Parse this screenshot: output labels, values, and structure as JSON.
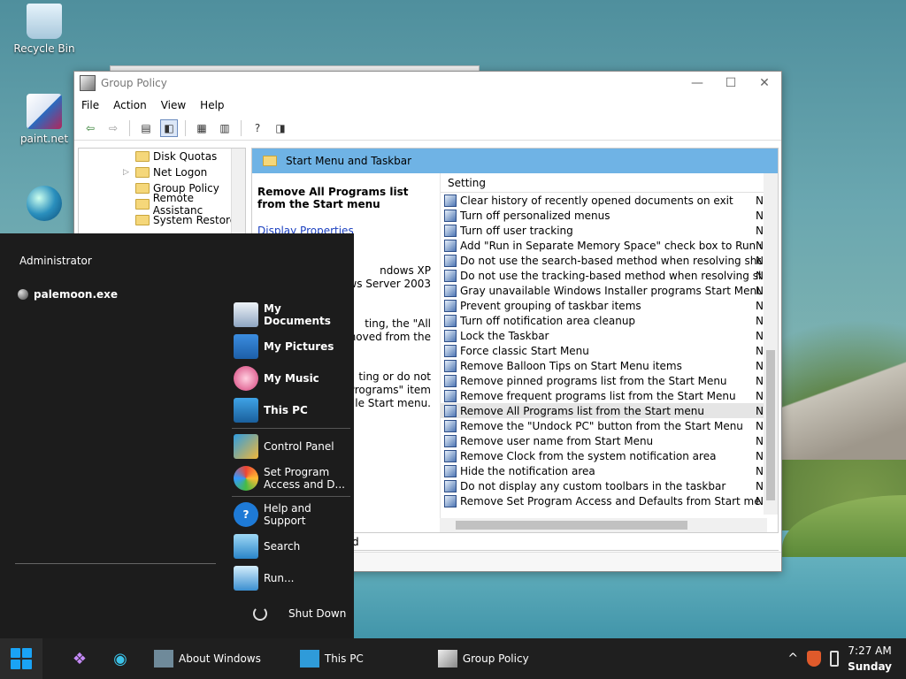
{
  "desktop": {
    "icons": [
      {
        "label": "Recycle Bin"
      },
      {
        "label": "paint.net"
      }
    ]
  },
  "group_policy": {
    "title": "Group Policy",
    "menu": [
      "File",
      "Action",
      "View",
      "Help"
    ],
    "tree_items": [
      "Disk Quotas",
      "Net Logon",
      "Group Policy",
      "Remote Assistanc",
      "System Restore"
    ],
    "header_title": "Start Menu and Taskbar",
    "description_title": "Remove All Programs list from the Start menu",
    "description_lines": [
      "Display Properties",
      "ndows XP",
      "ows Server 2003",
      "ting, the \"All",
      "moved from the",
      "ting or do not",
      "Programs\" item",
      "le Start menu."
    ],
    "column_header": "Setting",
    "settings": [
      "Clear history of recently opened documents on exit",
      "Turn off personalized menus",
      "Turn off user tracking",
      "Add \"Run in Separate Memory Space\" check box to Run dial...",
      "Do not use the search-based method when resolving shell s...",
      "Do not use the tracking-based method when resolving shell ...",
      "Gray unavailable Windows Installer programs Start Menu sh...",
      "Prevent grouping of taskbar items",
      "Turn off notification area cleanup",
      "Lock the Taskbar",
      "Force classic Start Menu",
      "Remove Balloon Tips on Start Menu items",
      "Remove pinned programs list from the Start Menu",
      "Remove frequent programs list from the Start Menu",
      "Remove All Programs list from the Start menu",
      "Remove the \"Undock PC\" button from the Start Menu",
      "Remove user name from Start Menu",
      "Remove Clock from the system notification area",
      "Hide the notification area",
      "Do not display any custom toolbars in the taskbar",
      "Remove Set Program Access and Defaults from Start menu"
    ],
    "selected_index": 14,
    "state_col": "N",
    "tab_label": "d"
  },
  "start_menu": {
    "user": "Administrator",
    "pinned": "palemoon.exe",
    "links": [
      {
        "label": "My Documents",
        "bold": true,
        "icon": "ic-docs",
        "name": "my-documents"
      },
      {
        "label": "My Pictures",
        "bold": true,
        "icon": "ic-pics",
        "name": "my-pictures"
      },
      {
        "label": "My Music",
        "bold": true,
        "icon": "ic-music",
        "name": "my-music"
      },
      {
        "label": "This PC",
        "bold": true,
        "icon": "ic-pc",
        "name": "this-pc"
      },
      {
        "sep": true
      },
      {
        "label": "Control Panel",
        "bold": false,
        "icon": "ic-cp",
        "name": "control-panel"
      },
      {
        "label": "Set Program Access and D...",
        "bold": false,
        "icon": "ic-set",
        "name": "set-program-access"
      },
      {
        "sep": true
      },
      {
        "label": "Help and Support",
        "bold": false,
        "icon": "ic-help",
        "name": "help-support"
      },
      {
        "label": "Search",
        "bold": false,
        "icon": "ic-search",
        "name": "search"
      },
      {
        "label": "Run...",
        "bold": false,
        "icon": "ic-run",
        "name": "run"
      }
    ],
    "shutdown": "Shut Down"
  },
  "taskbar": {
    "apps": [
      "About Windows",
      "This PC",
      "Group Policy"
    ],
    "time": "7:27 AM",
    "day": "Sunday"
  }
}
